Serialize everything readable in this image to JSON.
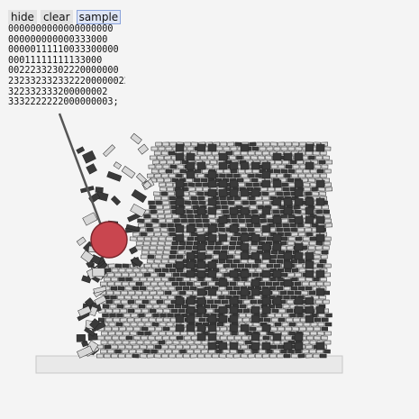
{
  "toolbar": {
    "hide_label": "hide",
    "clear_label": "clear",
    "sample_label": "sample",
    "active": "sample"
  },
  "grid_rows": [
    "0000000000000000000",
    "000000000000333000",
    "00000111110033300000",
    "00011111111133000",
    "00222332302220000000",
    "2323323323322200000022",
    "322332333200000002",
    "3332222222000000003;"
  ],
  "scene": {
    "wall_color": "#3a3a3a",
    "brick_light": "#d7d7d7",
    "ball_color": "#c9464f",
    "chain_color": "#555555",
    "ground_color": "#e9e9e9"
  }
}
